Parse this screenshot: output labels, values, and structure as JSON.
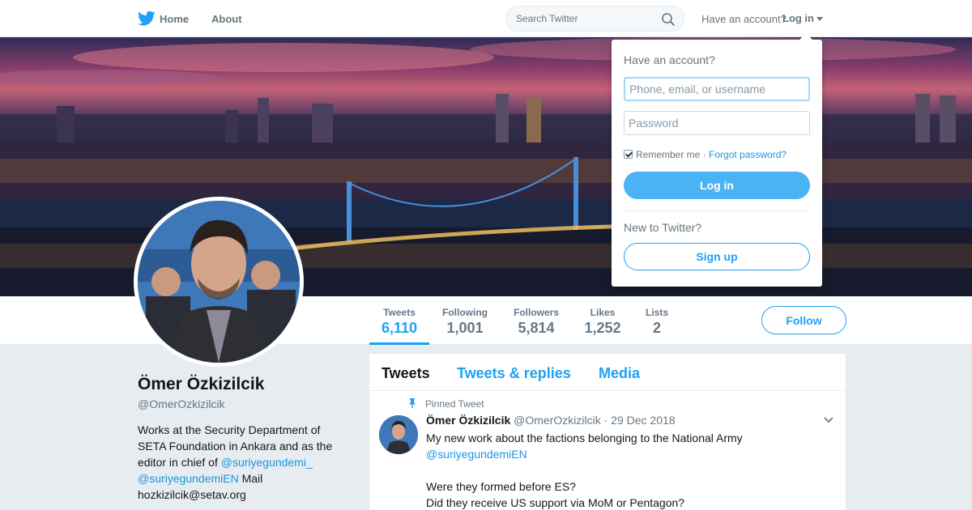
{
  "topbar": {
    "home_label": "Home",
    "about_label": "About",
    "search_placeholder": "Search Twitter",
    "have_account": "Have an account?",
    "login_label": "Log in"
  },
  "banner": {
    "icon": "city-bridge-night-photo"
  },
  "stats": [
    {
      "label": "Tweets",
      "value": "6,110"
    },
    {
      "label": "Following",
      "value": "1,001"
    },
    {
      "label": "Followers",
      "value": "5,814"
    },
    {
      "label": "Likes",
      "value": "1,252"
    },
    {
      "label": "Lists",
      "value": "2"
    }
  ],
  "follow_label": "Follow",
  "profile": {
    "name": "Ömer Özkizilcik",
    "handle": "@OmerOzkizilcik",
    "bio_1": "Works at the Security Department of SETA Foundation in Ankara and as the editor in chief of ",
    "bio_link_1": "@suriyegundemi_",
    "bio_link_2": "@suriyegundemiEN",
    "bio_2": " Mail hozkizilcik@setav.org"
  },
  "timeline": {
    "tabs": [
      "Tweets",
      "Tweets & replies",
      "Media"
    ],
    "pinned_label": "Pinned Tweet",
    "tweet": {
      "name": "Ömer Özkizilcik",
      "handle": "@OmerOzkizilcik",
      "separator": " · ",
      "date": "29 Dec 2018",
      "line_1": "My new work about the factions belonging to the National Army",
      "link": "@suriyegundemiEN",
      "line_3": "Were they formed before ES?",
      "line_4": "Did they receive US support via MoM or Pentagon?"
    }
  },
  "login_dropdown": {
    "title": "Have an account?",
    "username_placeholder": "Phone, email, or username",
    "password_placeholder": "Password",
    "remember_label": "Remember me",
    "separator": " · ",
    "forgot_label": "Forgot password?",
    "login_button": "Log in",
    "new_label": "New to Twitter?",
    "signup_button": "Sign up"
  },
  "colors": {
    "brand": "#1da1f2",
    "link": "#1b95e0",
    "login_button": "#4ab3f4",
    "muted": "#657786"
  }
}
